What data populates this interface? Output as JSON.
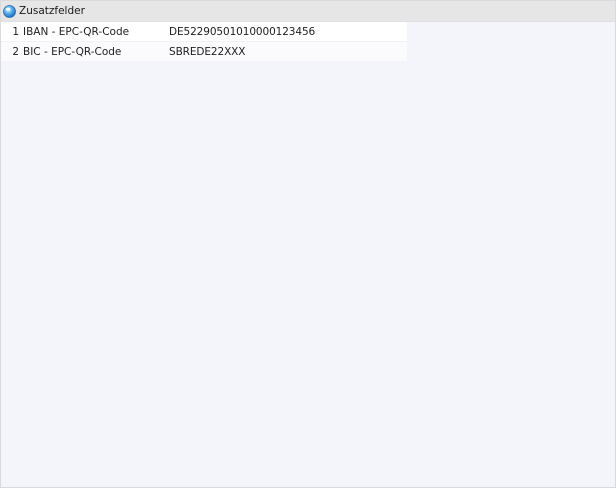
{
  "panel": {
    "title": "Zusatzfelder",
    "icon": "globe-icon"
  },
  "fields": [
    {
      "index": "1",
      "label": "IBAN - EPC-QR-Code",
      "value": "DE52290501010000123456"
    },
    {
      "index": "2",
      "label": "BIC - EPC-QR-Code",
      "value": "SBREDE22XXX"
    }
  ]
}
